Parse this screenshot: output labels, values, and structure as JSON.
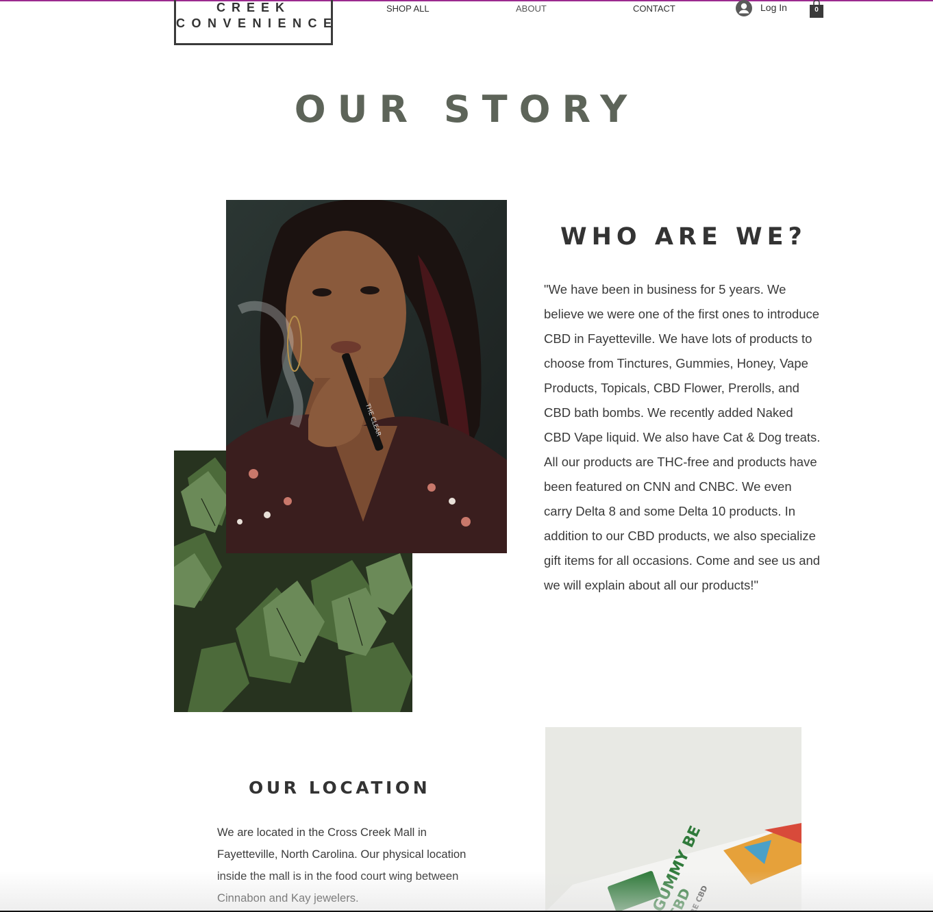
{
  "header": {
    "logo_line1": "CREEK",
    "logo_line2": "CONVENIENCE",
    "nav": [
      "SHOP ALL",
      "ABOUT",
      "CONTACT"
    ],
    "login_label": "Log In",
    "cart_count": "0"
  },
  "page": {
    "title": "OUR STORY"
  },
  "who": {
    "heading": "WHO ARE WE?",
    "text": "\"We have been in business for 5 years. We believe we were one of the first ones to introduce CBD in Fayetteville. We have lots of products to choose from Tinctures, Gummies, Honey, Vape Products, Topicals, CBD Flower, Prerolls, and CBD bath bombs. We recently added Naked CBD Vape liquid. We also have Cat & Dog treats. All our products are THC-free and products have been featured on CNN and CNBC. We even carry Delta 8 and some Delta 10 products. In addition to our CBD products, we also specialize gift items for all occasions. Come and see us and we will explain about all our products!\""
  },
  "location": {
    "heading": "OUR LOCATION",
    "text": "We are located in the Cross Creek Mall in Fayetteville, North Carolina. Our physical location inside the mall is in the food court wing between Cinnabon and Kay jewelers."
  },
  "images": {
    "woman_pen_label": "THE CLEAR",
    "gummy_label_line1": "GUMMY BE",
    "gummy_label_line2": "CBD",
    "gummy_label_line3": "PURE CBD"
  },
  "colors": {
    "accent_topline": "#9b2a8f",
    "title_color": "#5d6459",
    "text_color": "#3a3a3a"
  }
}
